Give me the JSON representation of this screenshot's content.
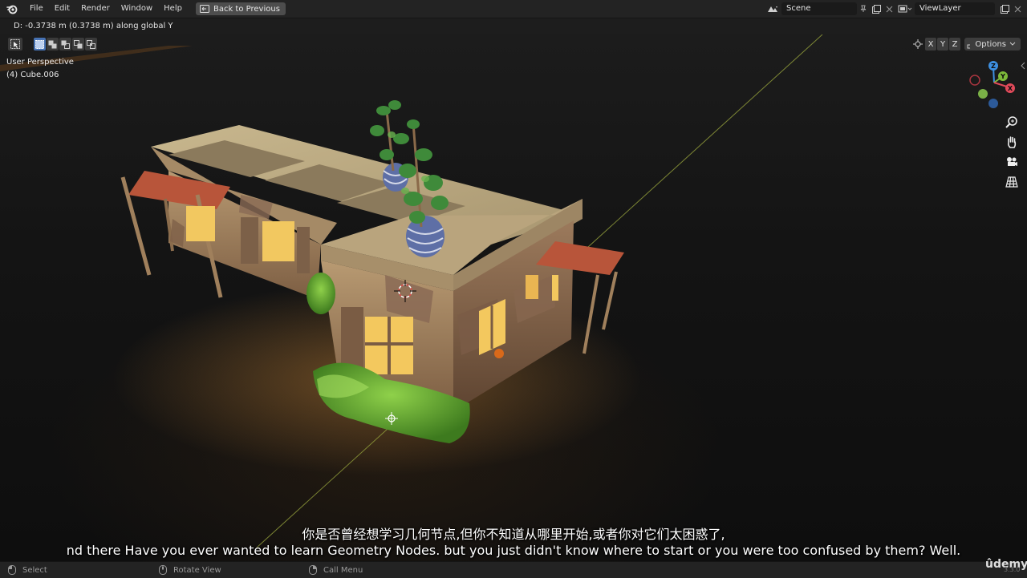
{
  "menu": {
    "items": [
      "File",
      "Edit",
      "Render",
      "Window",
      "Help"
    ],
    "back_label": "Back to Previous"
  },
  "scene_selector": {
    "value": "Scene"
  },
  "view_layer": {
    "value": "ViewLayer"
  },
  "status": {
    "transform_text": "D: -0.3738 m (0.3738 m) along global Y"
  },
  "viewport": {
    "perspective": "User Perspective",
    "active_object": "(4) Cube.006",
    "axis_x": "X",
    "axis_y": "Y",
    "axis_z": "Z",
    "options_label": "Options",
    "gizmo": {
      "x": "X",
      "y": "Y",
      "z": "Z"
    }
  },
  "subtitles": {
    "zh": "你是否曾经想学习几何节点,但你不知道从哪里开始,或者你对它们太困惑了,",
    "en": "nd there Have you ever wanted to learn Geometry Nodes. but you just didn't know where to start or you were too confused by them? Well."
  },
  "bottom_bar": {
    "select": "Select",
    "rotate": "Rotate View",
    "call_menu": "Call Menu"
  },
  "watermark": "ûdemy",
  "version": "3.3.0",
  "colors": {
    "accent_blue": "#4772b3",
    "axis_x": "#e04a5a",
    "axis_y": "#7dbb3a",
    "axis_z": "#3d8fe0"
  }
}
